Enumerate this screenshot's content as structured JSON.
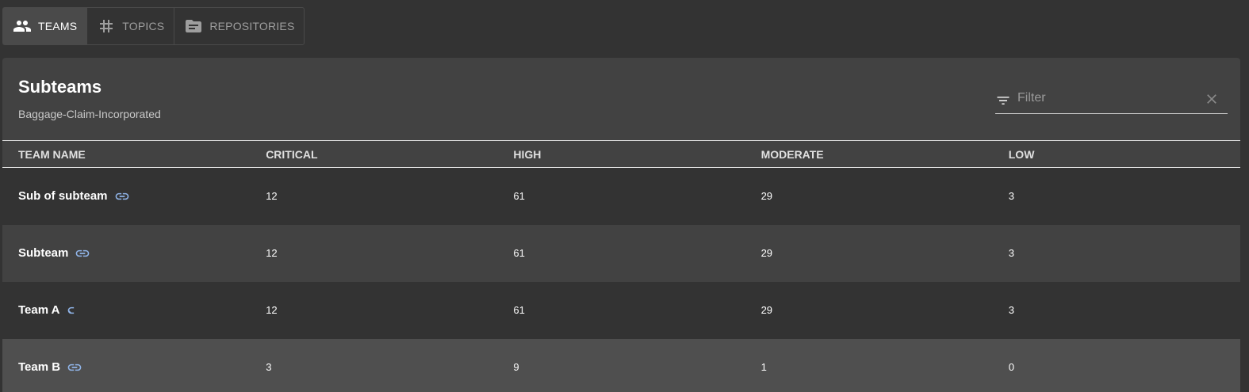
{
  "tabs": [
    {
      "label": "TEAMS",
      "icon": "people-icon",
      "active": true
    },
    {
      "label": "TOPICS",
      "icon": "hashtag-icon",
      "active": false
    },
    {
      "label": "REPOSITORIES",
      "icon": "folder-icon",
      "active": false
    }
  ],
  "card": {
    "title": "Subteams",
    "subtitle": "Baggage-Claim-Incorporated"
  },
  "filter": {
    "placeholder": "Filter",
    "value": ""
  },
  "table": {
    "headers": {
      "name": "TEAM NAME",
      "critical": "CRITICAL",
      "high": "HIGH",
      "moderate": "MODERATE",
      "low": "LOW"
    },
    "rows": [
      {
        "name": "Sub of subteam",
        "critical": "12",
        "high": "61",
        "moderate": "29",
        "low": "3"
      },
      {
        "name": "Subteam",
        "critical": "12",
        "high": "61",
        "moderate": "29",
        "low": "3"
      },
      {
        "name": "Team A",
        "critical": "12",
        "high": "61",
        "moderate": "29",
        "low": "3"
      },
      {
        "name": "Team B",
        "critical": "3",
        "high": "9",
        "moderate": "1",
        "low": "0"
      }
    ]
  },
  "colors": {
    "link_icon": "#90b4e8",
    "background": "#333333",
    "card": "#424242"
  }
}
